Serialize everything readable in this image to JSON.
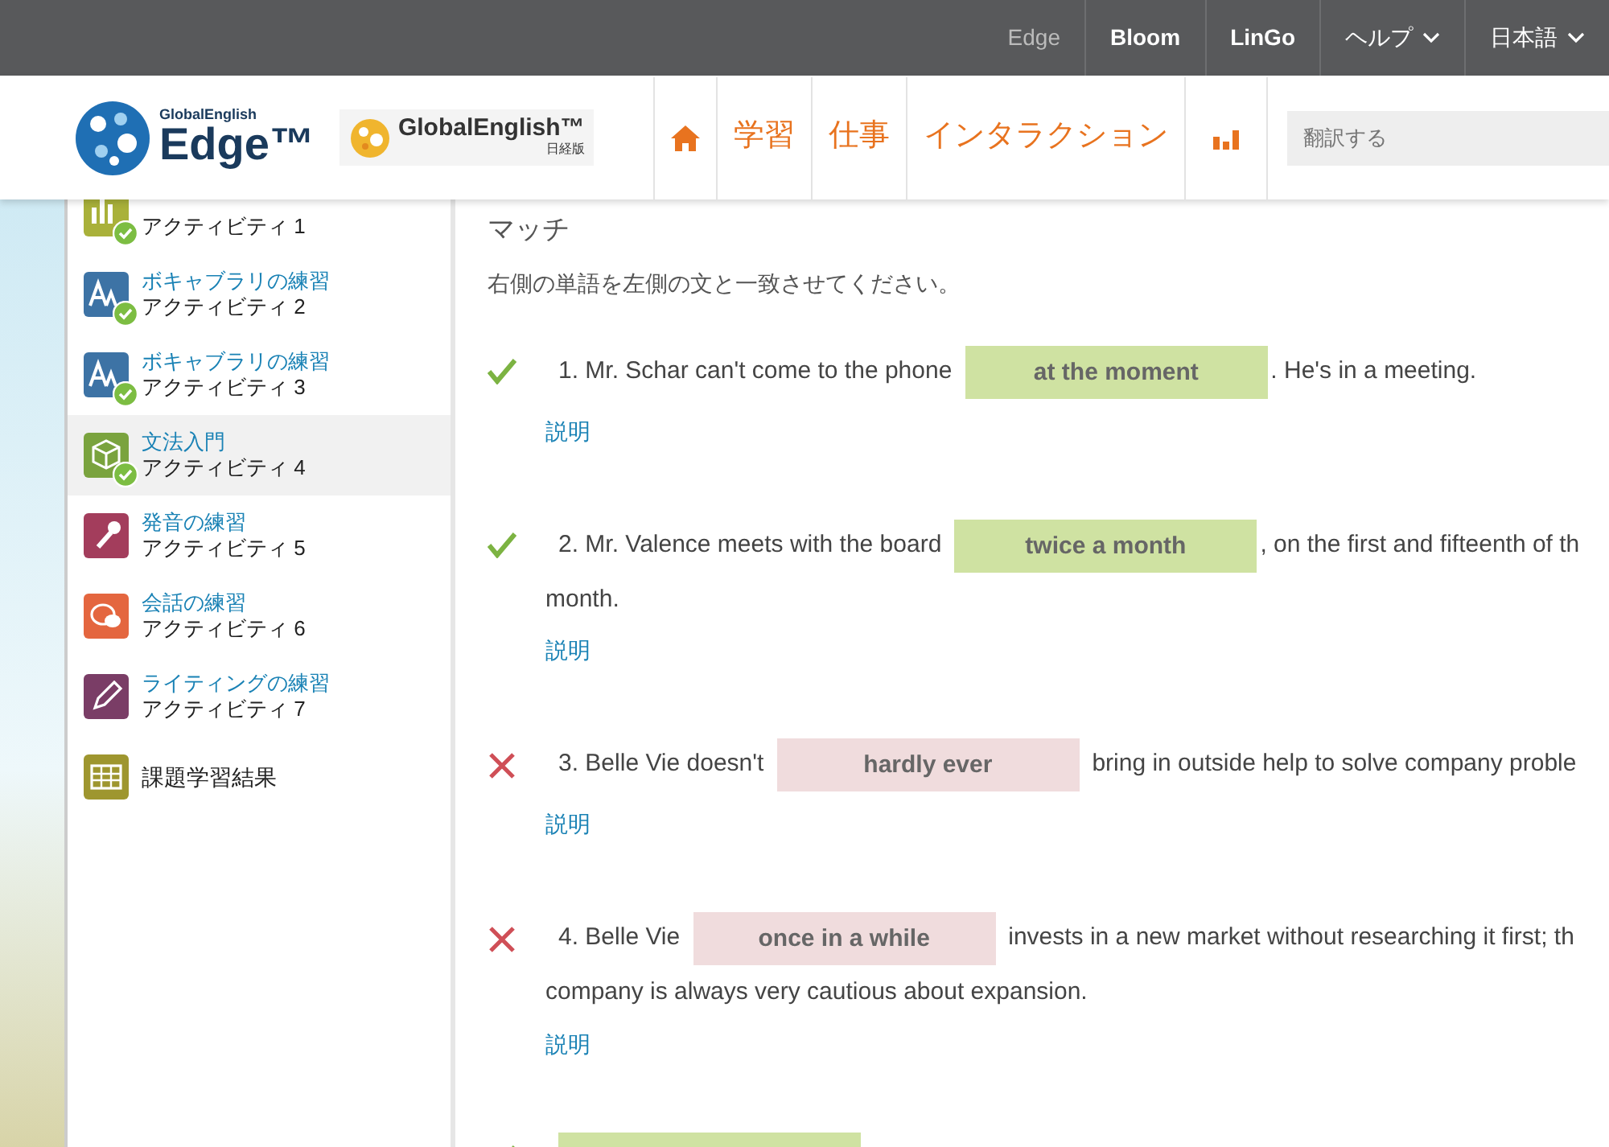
{
  "top_links": [
    {
      "label": "Edge",
      "selected": true,
      "dropdown": false
    },
    {
      "label": "Bloom",
      "selected": false,
      "dropdown": false
    },
    {
      "label": "LinGo",
      "selected": false,
      "dropdown": false
    },
    {
      "label": "ヘルプ",
      "selected": false,
      "dropdown": true
    },
    {
      "label": "日本語",
      "selected": false,
      "dropdown": true
    }
  ],
  "logos": [
    {
      "kind": "edge",
      "small": "GlobalEnglish",
      "big": "Edge",
      "mark": "™"
    },
    {
      "kind": "partner",
      "big": "GlobalEnglish",
      "mark": "™",
      "sub": "日経版"
    }
  ],
  "nav": [
    {
      "kind": "home"
    },
    {
      "kind": "text",
      "label": "学習"
    },
    {
      "kind": "text",
      "label": "仕事"
    },
    {
      "kind": "text",
      "label": "インタラクション"
    },
    {
      "kind": "chart"
    }
  ],
  "search": {
    "placeholder": "翻訳する"
  },
  "sidebar": [
    {
      "kind": "chart",
      "color": "#a9b13a",
      "subtitle": "アクティビティ 1",
      "completed": true,
      "selected": false
    },
    {
      "kind": "letters",
      "color": "#3d73a5",
      "title": "ボキャブラリの練習",
      "subtitle": "アクティビティ 2",
      "completed": true,
      "selected": false
    },
    {
      "kind": "letters",
      "color": "#3d73a5",
      "title": "ボキャブラリの練習",
      "subtitle": "アクティビティ 3",
      "completed": true,
      "selected": false
    },
    {
      "kind": "cube",
      "color": "#7aa33e",
      "title": "文法入門",
      "subtitle": "アクティビティ 4",
      "completed": true,
      "selected": true
    },
    {
      "kind": "mic",
      "color": "#a33d5c",
      "title": "発音の練習",
      "subtitle": "アクティビティ 5",
      "completed": false,
      "selected": false
    },
    {
      "kind": "speech",
      "color": "#e4663f",
      "title": "会話の練習",
      "subtitle": "アクティビティ 6",
      "completed": false,
      "selected": false
    },
    {
      "kind": "pencil",
      "color": "#7a3d66",
      "title": "ライティングの練習",
      "subtitle": "アクティビティ 7",
      "completed": false,
      "selected": false
    },
    {
      "kind": "grid",
      "color": "#9e962f",
      "title": "課題学習結果",
      "completed": false,
      "selected": false
    }
  ],
  "heading": "マッチ",
  "instruction": "右側の単語を左側の文と一致させてください。",
  "questions": [
    {
      "correct": true,
      "before": "1. Mr. Schar can't come to the phone",
      "answer": "at the moment",
      "after": ". He's in a meeting.",
      "explain": "説明"
    },
    {
      "correct": true,
      "before": "2. Mr. Valence meets with the board",
      "answer": "twice a month",
      "after": ", on the first and fifteenth of th",
      "continuation": "month.",
      "explain": "説明"
    },
    {
      "correct": false,
      "before": "3. Belle Vie doesn't",
      "answer": "hardly ever",
      "after": "bring in outside help to solve company proble",
      "explain": "説明"
    },
    {
      "correct": false,
      "before": "4. Belle Vie",
      "answer": "once in a while",
      "after": "invests in a new market without researching it first; th",
      "continuation": "company is always very cautious about expansion.",
      "explain": "説明"
    },
    {
      "correct": true
    }
  ]
}
